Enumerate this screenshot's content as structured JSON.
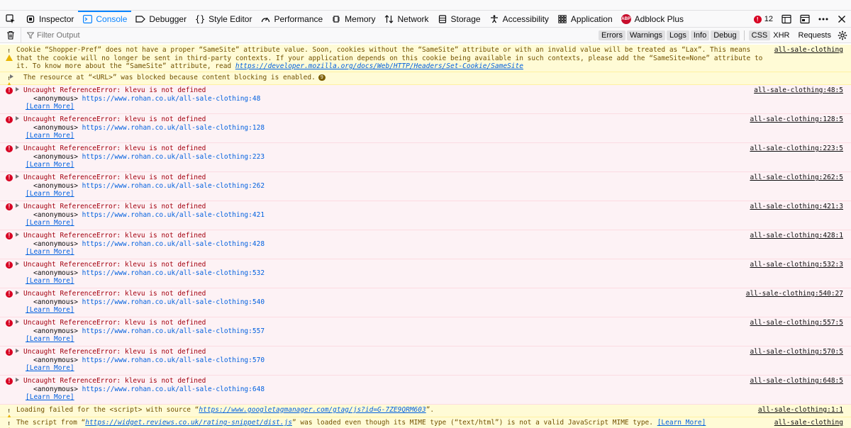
{
  "toolbar": {
    "tabs": [
      {
        "label": "Inspector"
      },
      {
        "label": "Console"
      },
      {
        "label": "Debugger"
      },
      {
        "label": "Style Editor"
      },
      {
        "label": "Performance"
      },
      {
        "label": "Memory"
      },
      {
        "label": "Network"
      },
      {
        "label": "Storage"
      },
      {
        "label": "Accessibility"
      },
      {
        "label": "Application"
      },
      {
        "label": "Adblock Plus"
      }
    ],
    "abp_badge": "ABP",
    "error_count": "12",
    "accent": "#0a84ff"
  },
  "filterbar": {
    "placeholder": "Filter Output",
    "levels": [
      "Errors",
      "Warnings",
      "Logs",
      "Info",
      "Debug"
    ],
    "css": "CSS",
    "xhr": "XHR",
    "requests": "Requests"
  },
  "messages": {
    "cookie": {
      "text_pre": "Cookie “Shopper-Pref” does not have a proper “SameSite” attribute value. Soon, cookies without the “SameSite” attribute or with an invalid value will be treated as “Lax”. This means that the cookie will no longer be sent in third-party contexts. If your application depends on this cookie being available in such contexts, please add the “SameSite=None” attribute to it. To know more about the “SameSite” attribute, read ",
      "link": "https://developer.mozilla.org/docs/Web/HTTP/Headers/Set-Cookie/SameSite",
      "location": "all-sale-clothing"
    },
    "blocked": {
      "text": "The resource at “<URL>” was blocked because content blocking is enabled.",
      "badge": "9"
    },
    "errors": [
      {
        "text": "Uncaught ReferenceError: klevu is not defined",
        "frame_label": "<anonymous>",
        "frame_url": "https://www.rohan.co.uk/all-sale-clothing:48",
        "learn": "[Learn More]",
        "location": "all-sale-clothing:48:5"
      },
      {
        "text": "Uncaught ReferenceError: klevu is not defined",
        "frame_label": "<anonymous>",
        "frame_url": "https://www.rohan.co.uk/all-sale-clothing:128",
        "learn": "[Learn More]",
        "location": "all-sale-clothing:128:5"
      },
      {
        "text": "Uncaught ReferenceError: klevu is not defined",
        "frame_label": "<anonymous>",
        "frame_url": "https://www.rohan.co.uk/all-sale-clothing:223",
        "learn": "[Learn More]",
        "location": "all-sale-clothing:223:5"
      },
      {
        "text": "Uncaught ReferenceError: klevu is not defined",
        "frame_label": "<anonymous>",
        "frame_url": "https://www.rohan.co.uk/all-sale-clothing:262",
        "learn": "[Learn More]",
        "location": "all-sale-clothing:262:5"
      },
      {
        "text": "Uncaught ReferenceError: klevu is not defined",
        "frame_label": "<anonymous>",
        "frame_url": "https://www.rohan.co.uk/all-sale-clothing:421",
        "learn": "[Learn More]",
        "location": "all-sale-clothing:421:3"
      },
      {
        "text": "Uncaught ReferenceError: klevu is not defined",
        "frame_label": "<anonymous>",
        "frame_url": "https://www.rohan.co.uk/all-sale-clothing:428",
        "learn": "[Learn More]",
        "location": "all-sale-clothing:428:1"
      },
      {
        "text": "Uncaught ReferenceError: klevu is not defined",
        "frame_label": "<anonymous>",
        "frame_url": "https://www.rohan.co.uk/all-sale-clothing:532",
        "learn": "[Learn More]",
        "location": "all-sale-clothing:532:3"
      },
      {
        "text": "Uncaught ReferenceError: klevu is not defined",
        "frame_label": "<anonymous>",
        "frame_url": "https://www.rohan.co.uk/all-sale-clothing:540",
        "learn": "[Learn More]",
        "location": "all-sale-clothing:540:27"
      },
      {
        "text": "Uncaught ReferenceError: klevu is not defined",
        "frame_label": "<anonymous>",
        "frame_url": "https://www.rohan.co.uk/all-sale-clothing:557",
        "learn": "[Learn More]",
        "location": "all-sale-clothing:557:5"
      },
      {
        "text": "Uncaught ReferenceError: klevu is not defined",
        "frame_label": "<anonymous>",
        "frame_url": "https://www.rohan.co.uk/all-sale-clothing:570",
        "learn": "[Learn More]",
        "location": "all-sale-clothing:570:5"
      },
      {
        "text": "Uncaught ReferenceError: klevu is not defined",
        "frame_label": "<anonymous>",
        "frame_url": "https://www.rohan.co.uk/all-sale-clothing:648",
        "learn": "[Learn More]",
        "location": "all-sale-clothing:648:5"
      }
    ],
    "loading": {
      "text_pre": "Loading failed for the <script> with source “",
      "link": "https://www.googletagmanager.com/gtag/js?id=G-7ZE9QRM603",
      "text_post": "”.",
      "location": "all-sale-clothing:1:1"
    },
    "mime": {
      "text_pre": "The script from “",
      "link": "https://widget.reviews.co.uk/rating-snippet/dist.js",
      "text_post": "” was loaded even though its MIME type (“text/html”) is not a valid JavaScript MIME type. ",
      "learn": "[Learn More]",
      "location": "all-sale-clothing"
    }
  }
}
